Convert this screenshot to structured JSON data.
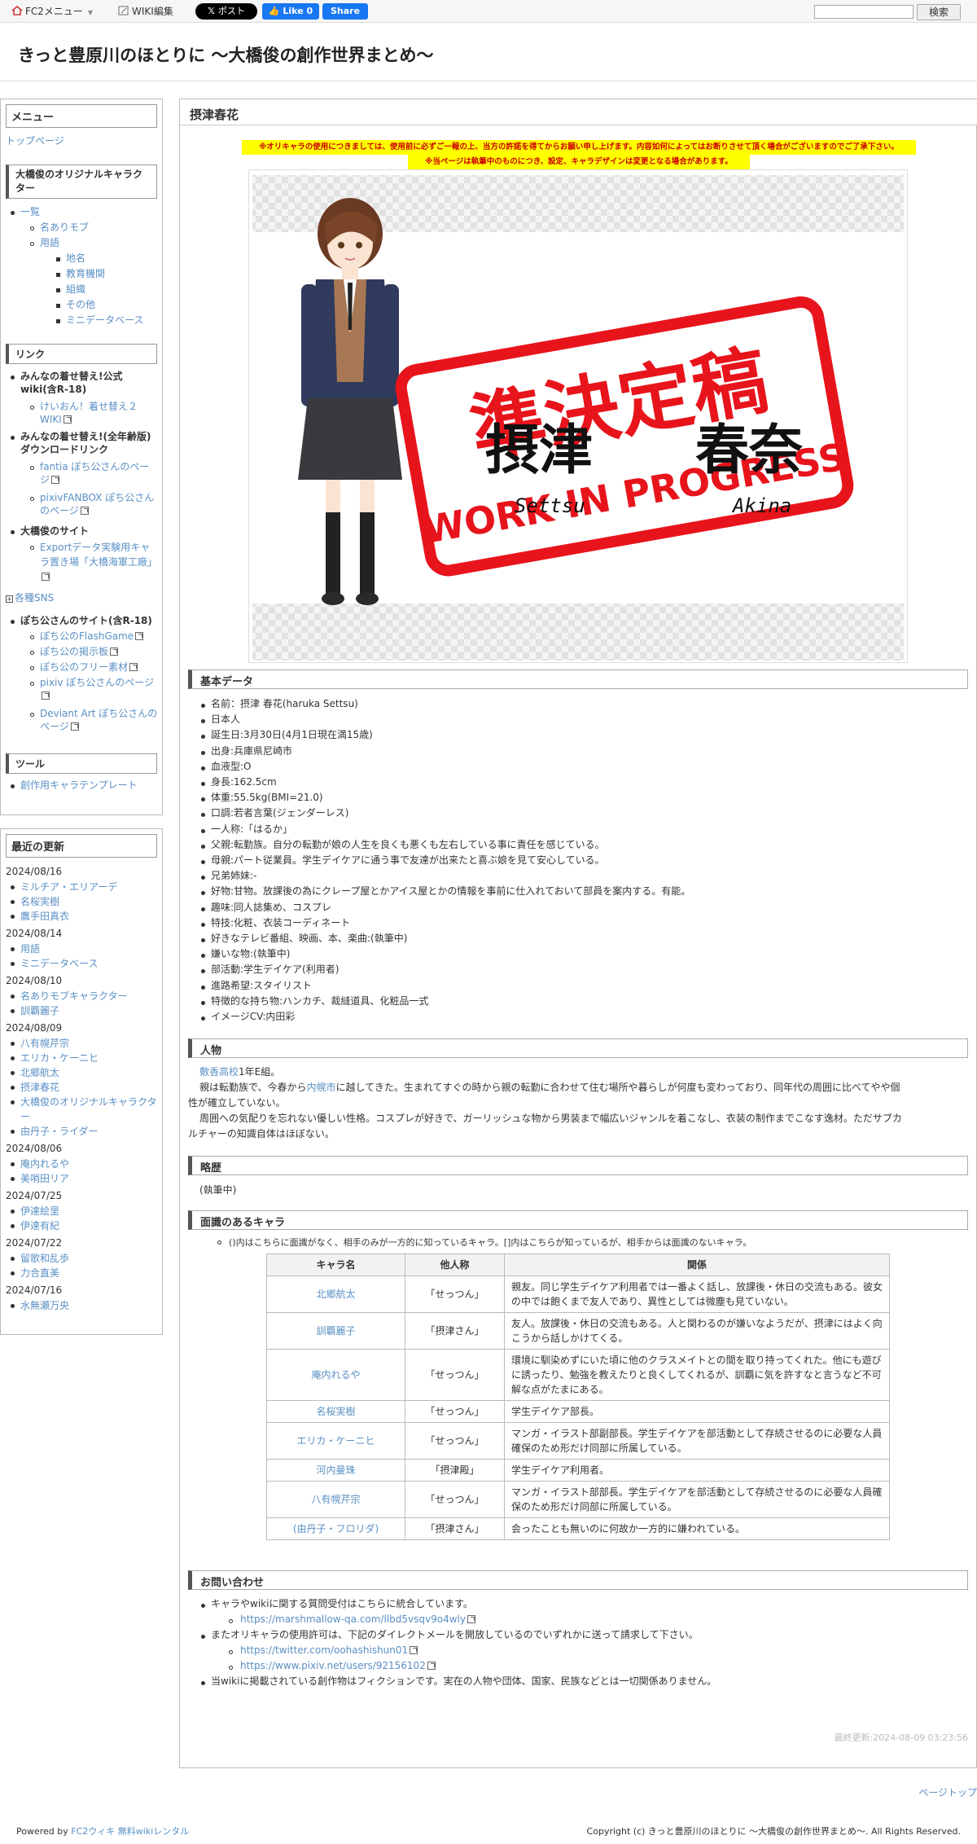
{
  "topbar": {
    "fc2_menu": "FC2メニュー",
    "wiki_edit": "WIKI編集",
    "x_post": "ポスト",
    "like": "Like 0",
    "share": "Share",
    "search_button": "検索"
  },
  "site_title": "きっと豊原川のほとりに 〜大橋俊の創作世界まとめ〜",
  "menu": {
    "title": "メニュー",
    "top_page": "トップページ",
    "section_orig": "大橋俊のオリジナルキャラクター",
    "orig_items": [
      "一覧"
    ],
    "orig_sub": [
      "名ありモブ",
      "用語"
    ],
    "orig_sub2": [
      "地名",
      "教育機関",
      "組織",
      "その他",
      "ミニデータベース"
    ],
    "links_title": "リンク",
    "link_groups": [
      {
        "title": "みんなの着せ替え!公式wiki(含R-18)",
        "items": [
          "けいおん！着せ替え２WIKI"
        ]
      },
      {
        "title": "みんなの着せ替え!(全年齢版)ダウンロードリンク",
        "items": [
          "fantia ぽち公さんのページ",
          "pixivFANBOX ぽち公さんのページ"
        ]
      },
      {
        "title": "大橋俊のサイト",
        "items": [
          "Exportデータ実験用キャラ置き場「大橋海軍工廠」"
        ]
      }
    ],
    "sns": "各種SNS",
    "pochi_title": "ぽち公さんのサイト(含R-18)",
    "pochi_items": [
      "ぽち公のFlashGame",
      "ぽち公の掲示板",
      "ぽち公のフリー素材",
      "pixiv ぽち公さんのページ",
      "Deviant Art ぽち公さんのページ"
    ],
    "tools_title": "ツール",
    "tools_items": [
      "創作用キャラテンプレート"
    ]
  },
  "recent": {
    "title": "最近の更新",
    "groups": [
      {
        "date": "2024/08/16",
        "items": [
          "ミルチア・エリアーデ",
          "名桜実樹",
          "鷹手田真衣"
        ]
      },
      {
        "date": "2024/08/14",
        "items": [
          "用語",
          "ミニデータベース"
        ]
      },
      {
        "date": "2024/08/10",
        "items": [
          "名ありモブキャラクター",
          "訓覇麗子"
        ]
      },
      {
        "date": "2024/08/09",
        "items": [
          "八有幌芹宗",
          "エリカ・ケーニヒ",
          "北郷航太",
          "摂津春花",
          "大橋俊のオリジナルキャラクター",
          "由丹子・ライダー"
        ]
      },
      {
        "date": "2024/08/06",
        "items": [
          "庵内れるや",
          "美哨田リア"
        ]
      },
      {
        "date": "2024/07/25",
        "items": [
          "伊達絵里",
          "伊達有紀"
        ]
      },
      {
        "date": "2024/07/22",
        "items": [
          "留歌和乱歩",
          "力合直美"
        ]
      },
      {
        "date": "2024/07/16",
        "items": [
          "水無瀬万央"
        ]
      }
    ]
  },
  "page_title": "摂津春花",
  "notice1": "※オリキャラの使用につきましては、使用前に必ずご一報の上、当方の許諾を得てからお願い申し上げます。内容如何によってはお断りさせて頂く場合がございますのでご了承下さい。",
  "notice2": "※当ページは執筆中のものにつき、設定、キャラデザインは変更となる場合があります。",
  "stamp": {
    "main": "準決定稿",
    "sub": "WORK IN PROGRESS"
  },
  "name_art": {
    "kanji1": "摂津",
    "kanji2": "春奈",
    "roman1": "Settsu",
    "roman2": "Akina"
  },
  "sections": {
    "basic": "基本データ",
    "person": "人物",
    "history": "略歴",
    "relations": "面識のあるキャラ",
    "contact": "お問い合わせ"
  },
  "basic_data": [
    "名前：摂津 春花(haruka Settsu)",
    "日本人",
    "誕生日:3月30日(4月1日現在満15歳)",
    "出身:兵庫県尼崎市",
    "血液型:O",
    "身長:162.5cm",
    "体重:55.5kg(BMI=21.0)",
    "口調:若者言葉(ジェンダーレス)",
    "一人称:「はるか」",
    "父親:転勤族。自分の転勤が娘の人生を良くも悪くも左右している事に責任を感じている。",
    "母親:パート従業員。学生デイケアに通う事で友達が出来たと喜ぶ娘を見て安心している。",
    "兄弟姉妹:-",
    "好物:甘物。放課後の為にクレープ屋とかアイス屋とかの情報を事前に仕入れておいて部員を案内する。有能。",
    "趣味:同人誌集め、コスプレ",
    "特技:化粧、衣装コーディネート",
    "好きなテレビ番組、映画、本、楽曲:(執筆中)",
    "嫌いな物:(執筆中)",
    "部活動:学生デイケア(利用者)",
    "進路希望:スタイリスト",
    "特徴的な持ち物:ハンカチ、裁縫道具、化粧品一式",
    "イメージCV:内田彩"
  ],
  "person_text": {
    "link1": "敷香高校",
    "t1": "1年E組。",
    "t2a": "親は転勤族で、今春から",
    "link2": "内幌市",
    "t2b": "に越してきた。生まれてすぐの時から親の転勤に合わせて住む場所や暮らしが何度も変わっており、同年代の周囲に比べてやや個",
    "t3": "性が確立していない。",
    "t4": "周囲への気配りを忘れない優しい性格。コスプレが好きで、ガーリッシュな物から男装まで幅広いジャンルを着こなし、衣装の制作までこなす逸材。ただサブカ",
    "t5": "ルチャーの知識自体はほぼない。"
  },
  "history_text": "(執筆中)",
  "relations_note": "()内はこちらに面識がなく、相手のみが一方的に知っているキャラ。[]内はこちらが知っているが、相手からは面識のないキャラ。",
  "relations_headers": [
    "キャラ名",
    "他人称",
    "関係"
  ],
  "relations": [
    {
      "name": "北郷航太",
      "call": "「せっつん」",
      "rel": "親友。同じ学生デイケア利用者では一番よく話し、放課後・休日の交流もある。彼女の中では飽くまで友人であり、異性としては微塵も見ていない。"
    },
    {
      "name": "訓覇麗子",
      "call": "「摂津さん」",
      "rel": "友人。放課後・休日の交流もある。人と関わるのが嫌いなようだが、摂津にはよく向こうから話しかけてくる。"
    },
    {
      "name": "庵内れるや",
      "call": "「せっつん」",
      "rel": "環境に馴染めずにいた頃に他のクラスメイトとの間を取り持ってくれた。他にも遊びに誘ったり、勉強を教えたりと良くしてくれるが、訓覇に気を許すなと言うなど不可解な点がたまにある。"
    },
    {
      "name": "名桜実樹",
      "call": "「せっつん」",
      "rel": "学生デイケア部長。"
    },
    {
      "name": "エリカ・ケーニヒ",
      "call": "「せっつん」",
      "rel": "マンガ・イラスト部副部長。学生デイケアを部活動として存続させるのに必要な人員確保のため形だけ同部に所属している。"
    },
    {
      "name": "河内曼珠",
      "call": "「摂津殿」",
      "rel": "学生デイケア利用者。"
    },
    {
      "name": "八有幌芹宗",
      "call": "「せっつん」",
      "rel": "マンガ・イラスト部部長。学生デイケアを部活動として存続させるのに必要な人員確保のため形だけ同部に所属している。"
    },
    {
      "name": "(由丹子・フロリダ)",
      "call": "「摂津さん」",
      "rel": "会ったことも無いのに何故か一方的に嫌われている。"
    }
  ],
  "contact": {
    "l1": "キャラやwikiに関する質問受付はこちらに統合しています。",
    "u1": "https://marshmallow-qa.com/llbd5vsqv9o4wly",
    "l2": "またオリキャラの使用許可は、下記のダイレクトメールを開放しているのでいずれかに送って請求して下さい。",
    "u2": "https://twitter.com/oohashishun01",
    "u3": "https://www.pixiv.net/users/92156102",
    "l3": "当wikiに掲載されている創作物はフィクションです。実在の人物や団体、国家、民族などとは一切関係ありません。"
  },
  "last_updated": "最終更新:2024-08-09 03:23:56",
  "page_top": "ページトップ",
  "footer": {
    "powered_prefix": "Powered by ",
    "powered_link": "FC2ウィキ 無料wikiレンタル",
    "copyright": "Copyright (c) きっと豊原川のほとりに 〜大橋俊の創作世界まとめ〜. All Rights Reserved."
  },
  "colors": {
    "link": "#5a8fc4",
    "stamp": "#e8141c",
    "notice_bg": "#ffff00",
    "notice_text": "#cc0000"
  }
}
